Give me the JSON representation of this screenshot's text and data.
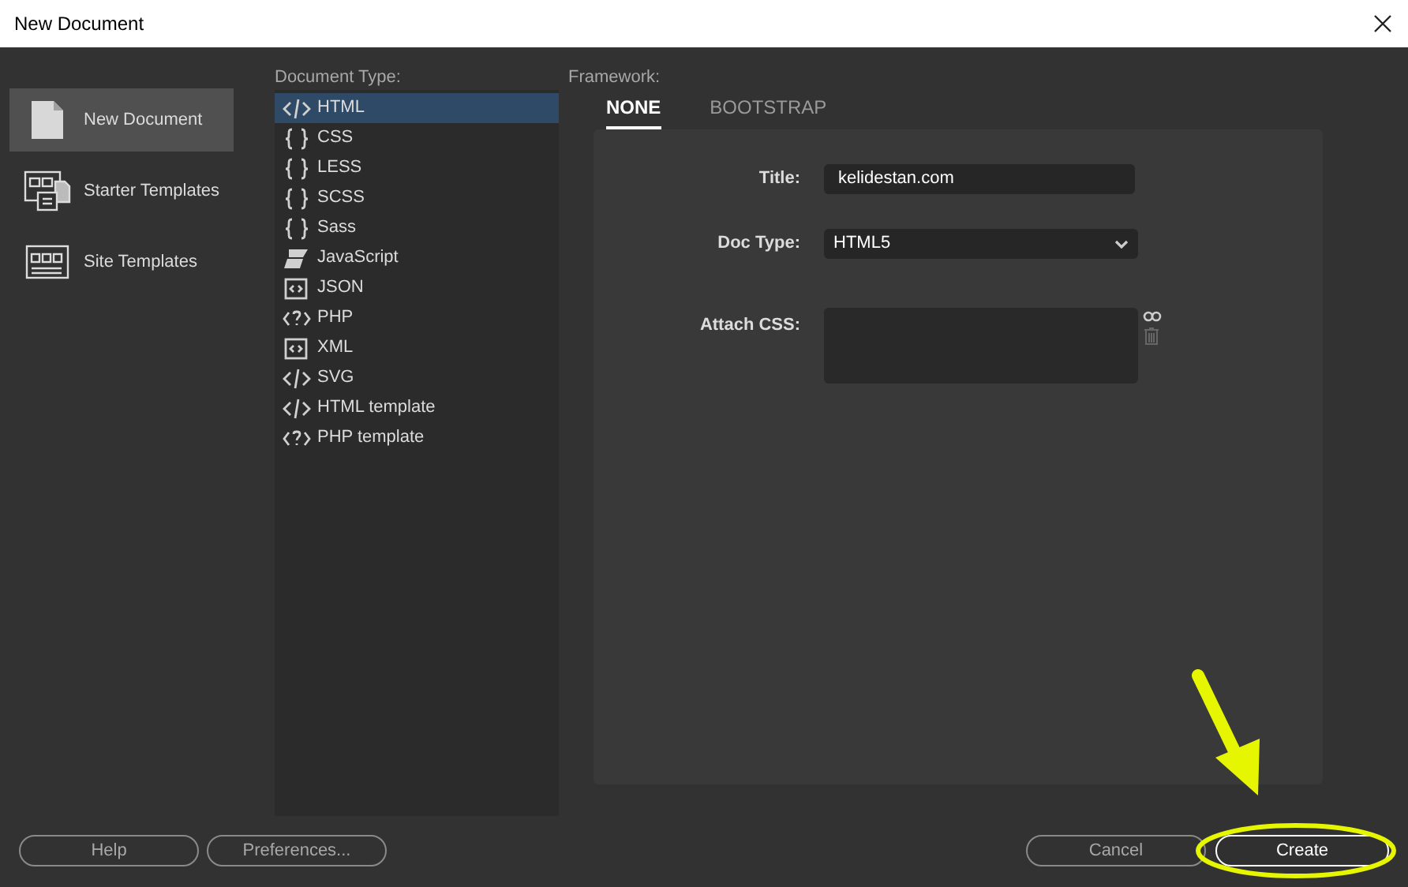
{
  "window": {
    "title": "New Document"
  },
  "sidebar": {
    "items": [
      {
        "label": "New Document",
        "kind": "document",
        "selected": true
      },
      {
        "label": "Starter Templates",
        "kind": "starter",
        "selected": false
      },
      {
        "label": "Site Templates",
        "kind": "site",
        "selected": false
      }
    ]
  },
  "document_type": {
    "label": "Document Type:",
    "items": [
      {
        "label": "HTML",
        "kind": "tag",
        "selected": true
      },
      {
        "label": "CSS",
        "kind": "braces",
        "selected": false
      },
      {
        "label": "LESS",
        "kind": "braces",
        "selected": false
      },
      {
        "label": "SCSS",
        "kind": "braces",
        "selected": false
      },
      {
        "label": "Sass",
        "kind": "braces",
        "selected": false
      },
      {
        "label": "JavaScript",
        "kind": "script",
        "selected": false
      },
      {
        "label": "JSON",
        "kind": "box",
        "selected": false
      },
      {
        "label": "PHP",
        "kind": "php",
        "selected": false
      },
      {
        "label": "XML",
        "kind": "box",
        "selected": false
      },
      {
        "label": "SVG",
        "kind": "tag",
        "selected": false
      },
      {
        "label": "HTML template",
        "kind": "tag",
        "selected": false
      },
      {
        "label": "PHP template",
        "kind": "php",
        "selected": false
      }
    ]
  },
  "framework": {
    "label": "Framework:",
    "tabs": [
      {
        "label": "NONE",
        "selected": true
      },
      {
        "label": "BOOTSTRAP",
        "selected": false
      }
    ],
    "title": {
      "label": "Title:",
      "value": "kelidestan.com"
    },
    "doc_type": {
      "label": "Doc Type:",
      "value": "HTML5"
    },
    "attach_css": {
      "label": "Attach CSS:"
    }
  },
  "buttons": [
    {
      "label": "Help",
      "kind": "secondary"
    },
    {
      "label": "Preferences...",
      "kind": "secondary"
    },
    {
      "label": "Cancel",
      "kind": "secondary"
    },
    {
      "label": "Create",
      "kind": "primary"
    }
  ]
}
